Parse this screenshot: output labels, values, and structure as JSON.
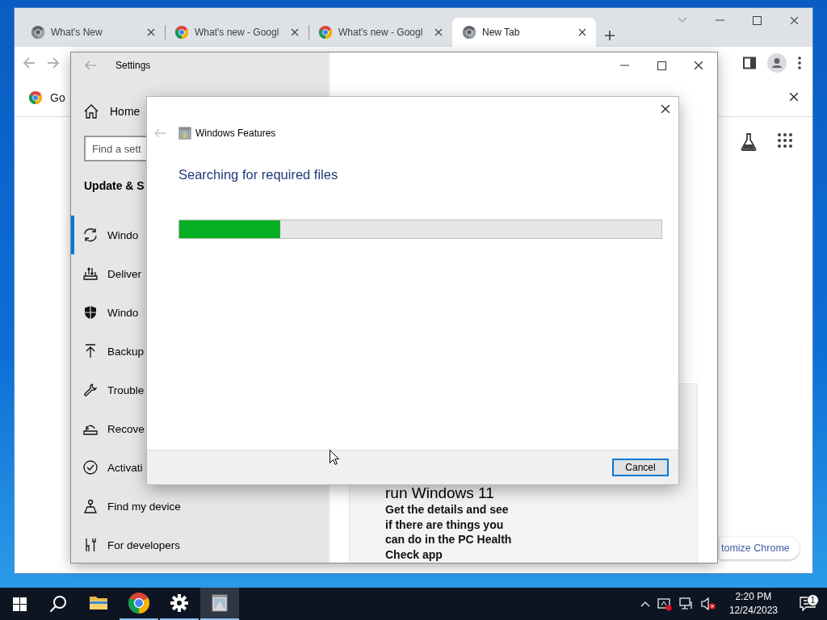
{
  "chrome": {
    "tabs": [
      {
        "title": "What's New",
        "selected": false,
        "kind": "mono"
      },
      {
        "title": "What's new - Googl",
        "selected": false,
        "kind": "color"
      },
      {
        "title": "What's new - Googl",
        "selected": false,
        "kind": "color"
      },
      {
        "title": "New Tab",
        "selected": true,
        "kind": "mono"
      }
    ],
    "infobar": {
      "text": "Go"
    },
    "customize_button": "tomize Chrome"
  },
  "settings": {
    "title": "Settings",
    "home": "Home",
    "search": {
      "placeholder": "Find a sett"
    },
    "section": "Update & S",
    "items": [
      {
        "label": "Windo",
        "selected": true
      },
      {
        "label": "Deliver",
        "selected": false
      },
      {
        "label": "Windo",
        "selected": false
      },
      {
        "label": "Backup",
        "selected": false
      },
      {
        "label": "Trouble",
        "selected": false
      },
      {
        "label": "Recove",
        "selected": false
      },
      {
        "label": "Activati",
        "selected": false
      },
      {
        "label": "Find my device",
        "selected": false
      },
      {
        "label": "For developers",
        "selected": false
      }
    ],
    "card": {
      "heading": "run Windows 11",
      "body": "Get the details and see if there are things you can do in the PC Health Check app"
    }
  },
  "dialog": {
    "title": "Windows Features",
    "heading": "Searching for required files",
    "progress": {
      "level": 0.21
    },
    "buttons": [
      "Cancel"
    ]
  },
  "taskbar": {
    "apps": [
      {
        "running": false,
        "selected": false
      },
      {
        "running": true,
        "selected": false
      },
      {
        "running": true,
        "selected": false
      },
      {
        "running": true,
        "selected": true
      }
    ],
    "clock": {
      "time": "2:20 PM",
      "date": "12/24/2023"
    },
    "notifications": "1"
  }
}
